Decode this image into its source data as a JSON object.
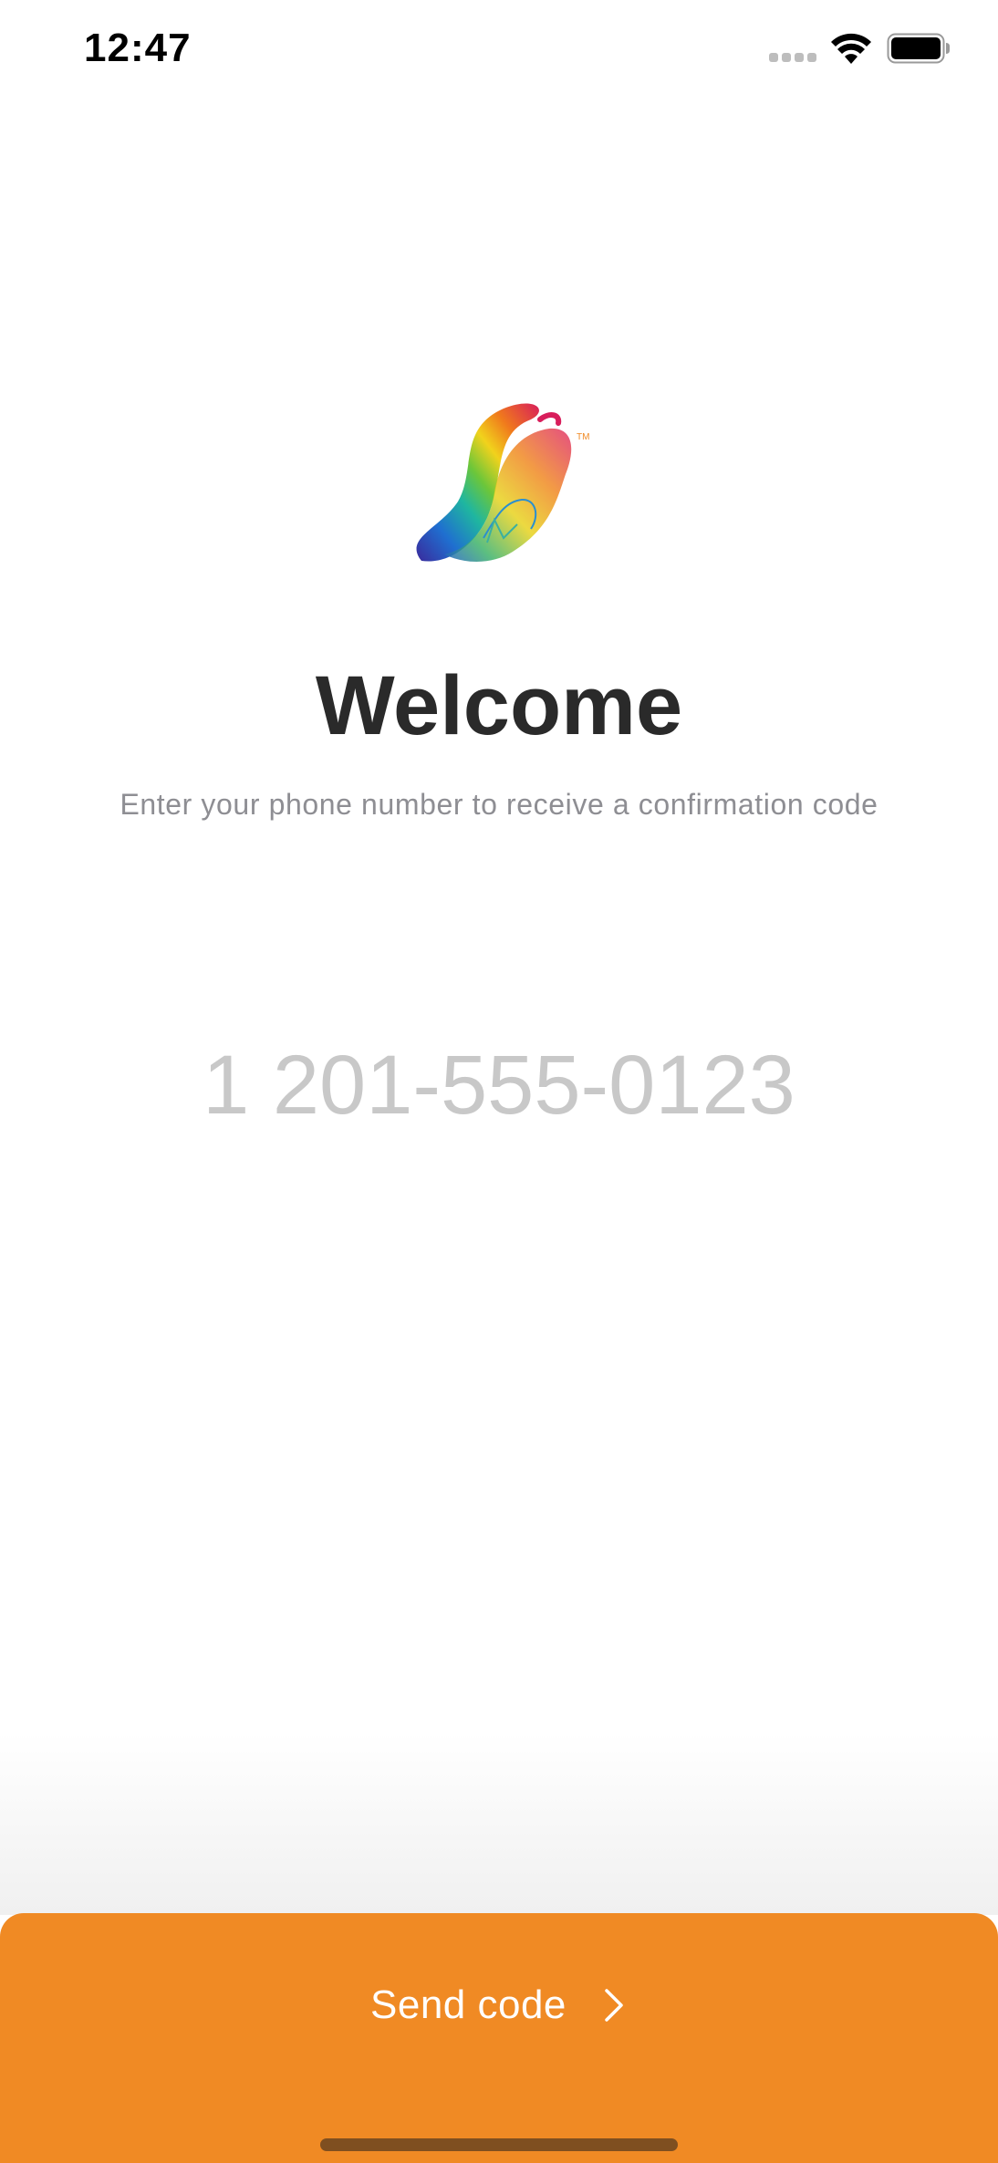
{
  "status_bar": {
    "time": "12:47",
    "icons": [
      "cellular-signal-icon",
      "wifi-icon",
      "battery-icon"
    ]
  },
  "logo": {
    "name": "rainbow-swirl-logo",
    "trademark": "TM"
  },
  "welcome": {
    "title": "Welcome",
    "subtitle": "Enter your phone number to receive a confirmation code"
  },
  "phone": {
    "value": "",
    "placeholder": "1 201-555-0123"
  },
  "send_button": {
    "label": "Send code",
    "icon": "chevron-right-icon",
    "color": "#f08a24"
  },
  "colors": {
    "accent": "#f08a24",
    "title": "#2a2a2a",
    "subtitle": "#8e8e93",
    "placeholder": "#c8c8c8"
  }
}
